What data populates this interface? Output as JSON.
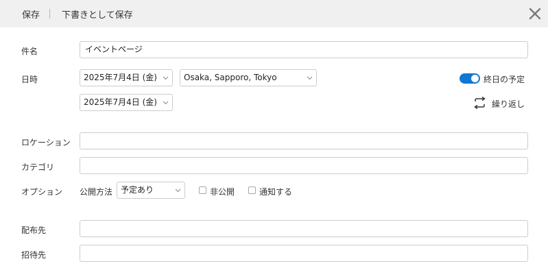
{
  "toolbar": {
    "save_label": "保存",
    "draft_label": "下書きとして保存"
  },
  "form": {
    "title": {
      "label": "件名",
      "value": "イベントページ"
    },
    "datetime": {
      "label": "日時",
      "start_date": "2025年7月4日 (金)",
      "timezone": "Osaka, Sapporo, Tokyo",
      "end_date": "2025年7月4日 (金)",
      "allday_label": "終日の予定",
      "allday_on": true,
      "repeat_label": "繰り返し"
    },
    "location": {
      "label": "ロケーション",
      "value": ""
    },
    "category": {
      "label": "カテゴリ",
      "value": ""
    },
    "options": {
      "label": "オプション",
      "visibility_label": "公開方法",
      "visibility_value": "予定あり",
      "private_label": "非公開",
      "private_checked": false,
      "notify_label": "通知する",
      "notify_checked": false
    },
    "distribution": {
      "label": "配布先",
      "value": ""
    },
    "invitees": {
      "label": "招待先",
      "value": ""
    }
  },
  "colors": {
    "accent": "#0f78d2",
    "toolbar_bg": "#f0f0f0",
    "border": "#cccccc"
  },
  "icons": {
    "close": "close-icon",
    "repeat": "repeat-icon",
    "chevron": "chevron-down-icon"
  }
}
